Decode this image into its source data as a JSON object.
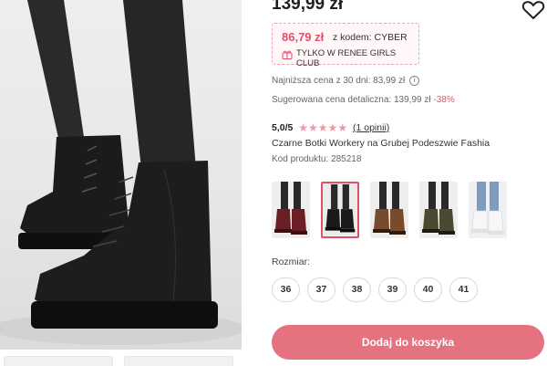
{
  "product": {
    "price": "139,99 zł",
    "promo_price": "86,79 zł",
    "promo_code_text": "z kodem: CYBER",
    "promo_club_text": "TYLKO W RENEE GIRLS CLUB",
    "lowest_price_label": "Najniższa cena z 30 dni: 83,99 zł",
    "suggested_price_label": "Sugerowana cena detaliczna: 139,99 zł",
    "discount": "-38%",
    "rating_score": "5,0/5",
    "rating_stars": "★★★★★",
    "reviews_link": "(1 opinii)",
    "name": "Czarne Botki Workery na Grubej Podeszwie Fashia",
    "code_label": "Kod produktu: 285218"
  },
  "icons": {
    "wishlist": "heart-icon",
    "promo": "gift-icon",
    "info": "info-icon"
  },
  "variants": [
    "burgundy",
    "black",
    "brown",
    "olive",
    "white"
  ],
  "variants_selected_index": 1,
  "size_label": "Rozmiar:",
  "sizes": [
    "36",
    "37",
    "38",
    "39",
    "40",
    "41"
  ],
  "cart_button": "Dodaj do koszyka",
  "colors": {
    "accent": "#e0506a",
    "button": "#e5727f"
  }
}
